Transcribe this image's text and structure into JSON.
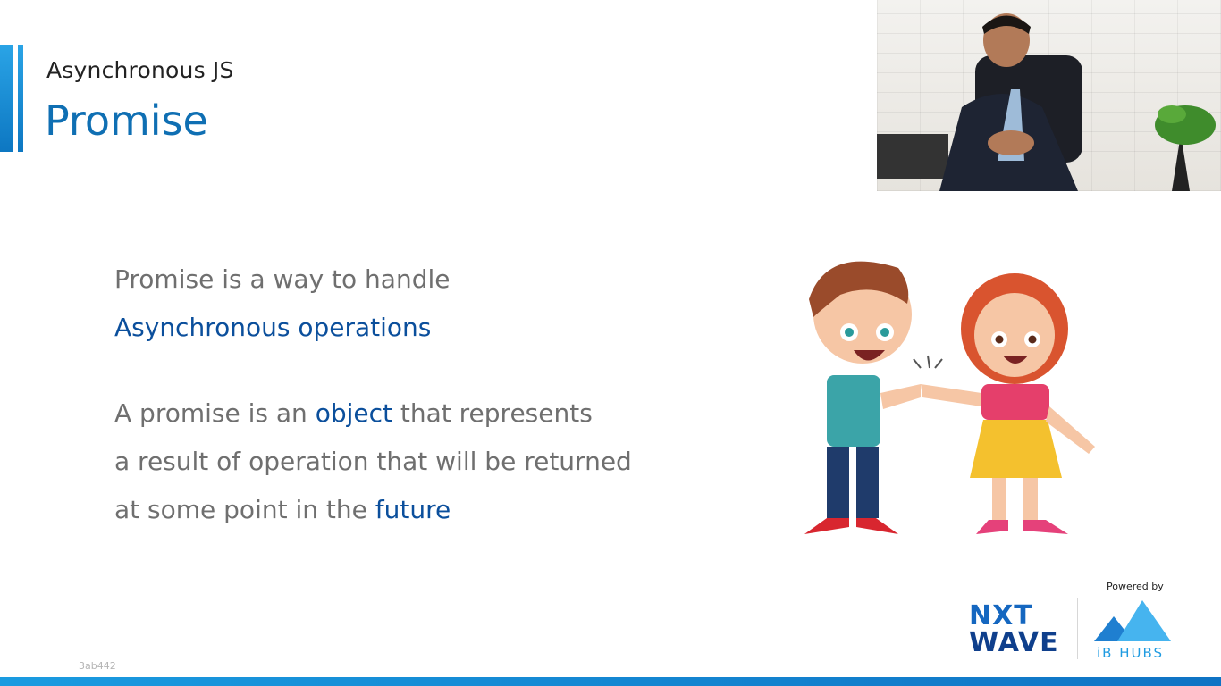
{
  "header": {
    "kicker": "Asynchronous JS",
    "title": "Promise"
  },
  "content": {
    "line1": "Promise is a way to handle",
    "line2": "Asynchronous operations",
    "p2_prefix": "A promise is an ",
    "p2_highlight": "object",
    "p2_suffix": " that represents",
    "p2_line2": "a result of operation that will be returned",
    "p2_line3_prefix": "at some point in the ",
    "p2_line3_highlight": "future"
  },
  "branding": {
    "powered_by": "Powered by",
    "nxt": "NXT",
    "wave": "WAVE",
    "ibhubs": "iB HUBS"
  },
  "watermark": "3ab442",
  "colors": {
    "accent": "#0f6fb3",
    "highlight": "#0b4f9c",
    "body_text": "#6f6f6f"
  },
  "icons": {
    "illustration": "two-kids-fist-bump",
    "video": "presenter-webcam"
  }
}
